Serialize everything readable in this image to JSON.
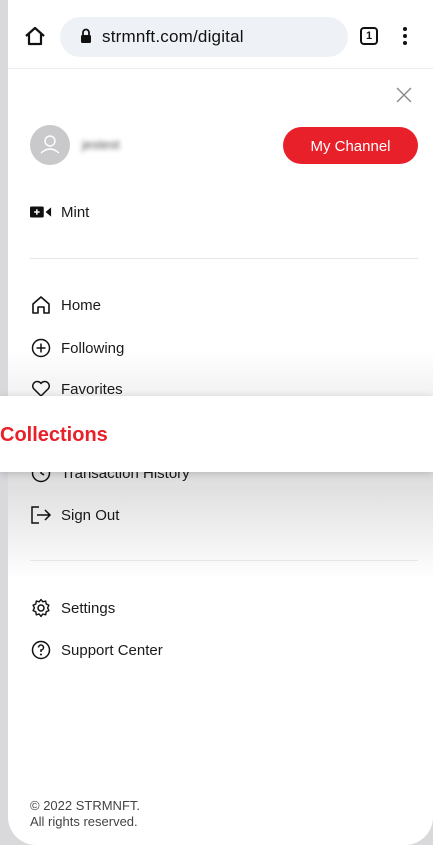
{
  "browser": {
    "url": "strmnft.com/digital",
    "tab_count": "1"
  },
  "drawer": {
    "username": "jestest",
    "channel_button": "My Channel",
    "mint_label": "Mint",
    "nav": [
      {
        "label": "Home",
        "icon": "home-icon"
      },
      {
        "label": "Following",
        "icon": "plus-circle-icon"
      },
      {
        "label": "Favorites",
        "icon": "heart-icon"
      },
      {
        "label": "Transaction History",
        "icon": "clock-icon"
      },
      {
        "label": "Sign Out",
        "icon": "sign-out-icon"
      }
    ],
    "secondary": [
      {
        "label": "Settings",
        "icon": "gear-icon"
      },
      {
        "label": "Support Center",
        "icon": "question-circle-icon"
      }
    ],
    "footer": {
      "line1": "© 2022 STRMNFT.",
      "line2": "All rights reserved."
    }
  },
  "banner": {
    "title": "Collections"
  },
  "colors": {
    "accent": "#e8202a",
    "background": "#ffffff"
  }
}
